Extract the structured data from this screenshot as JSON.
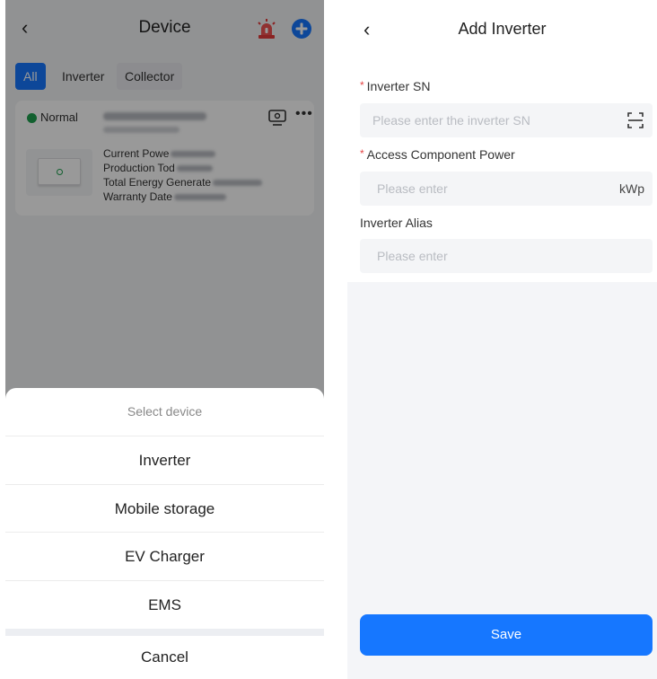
{
  "left": {
    "header": {
      "title": "Device",
      "back_icon": "chevron-left-icon",
      "alarm_icon": "alarm-light-icon",
      "add_icon": "plus-circle-icon"
    },
    "tabs": [
      {
        "label": "All",
        "active": true
      },
      {
        "label": "Inverter",
        "active": false
      },
      {
        "label": "Collector",
        "active": false
      }
    ],
    "device_card": {
      "status": "Normal",
      "status_color": "#1ea14f",
      "fields": [
        {
          "label": "Current Powe"
        },
        {
          "label": "Production Tod"
        },
        {
          "label": "Total Energy Generate"
        },
        {
          "label": "Warranty Date"
        }
      ]
    },
    "sheet": {
      "title": "Select device",
      "items": [
        "Inverter",
        "Mobile storage",
        "EV Charger",
        "EMS"
      ],
      "cancel": "Cancel"
    }
  },
  "right": {
    "header": {
      "title": "Add Inverter",
      "back_icon": "chevron-left-icon"
    },
    "form": {
      "required_marker": "*",
      "inverter_sn": {
        "label": "Inverter SN",
        "placeholder": "Please enter the inverter SN",
        "required": true
      },
      "component_power": {
        "label": "Access Component Power",
        "placeholder": "Please enter",
        "unit": "kWp",
        "required": true
      },
      "alias": {
        "label": "Inverter Alias",
        "placeholder": "Please enter",
        "required": false
      }
    },
    "save_label": "Save",
    "accent_color": "#1677ff"
  }
}
